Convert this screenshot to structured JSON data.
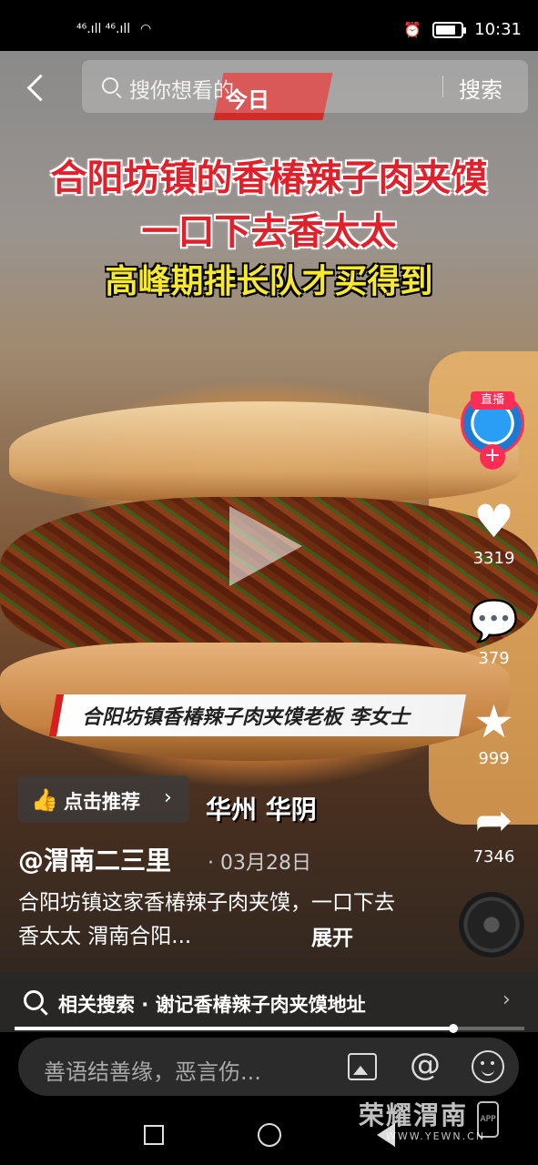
{
  "status_bar": {
    "signal_left": "⁴⁶.ıll ⁴⁶.ıll",
    "time": "10:31"
  },
  "header": {
    "search_placeholder": "搜你想看的",
    "search_button": "搜索",
    "logo_text": "今日"
  },
  "video": {
    "caption_line1": "合阳坊镇的香椿辣子肉夹馍",
    "caption_line2": "一口下去香太太",
    "caption_line3": "高峰期排长队才买得到",
    "lower_third": "合阳坊镇香椿辣子肉夹馍老板  李女士",
    "location_subtitle": "华州 华阴"
  },
  "actions": {
    "live_tag": "直播",
    "likes": "3319",
    "comments": "379",
    "favorites": "999",
    "shares": "7346"
  },
  "recommend_label": "点击推荐",
  "post": {
    "author": "@渭南二三里",
    "date": "· 03月28日",
    "description": "合阳坊镇这家香椿辣子肉夹馍，一口下去香太太 渭南合阳...",
    "expand": "展开"
  },
  "related_search": "相关搜索 · 谢记香椿辣子肉夹馍地址",
  "progress": {
    "fraction": 0.86
  },
  "comment_bar": {
    "placeholder": "善语结善缘，恶言伤..."
  },
  "watermark": {
    "name": "荣耀渭南",
    "url": "WWW.YEWN.CN",
    "app": "APP"
  }
}
